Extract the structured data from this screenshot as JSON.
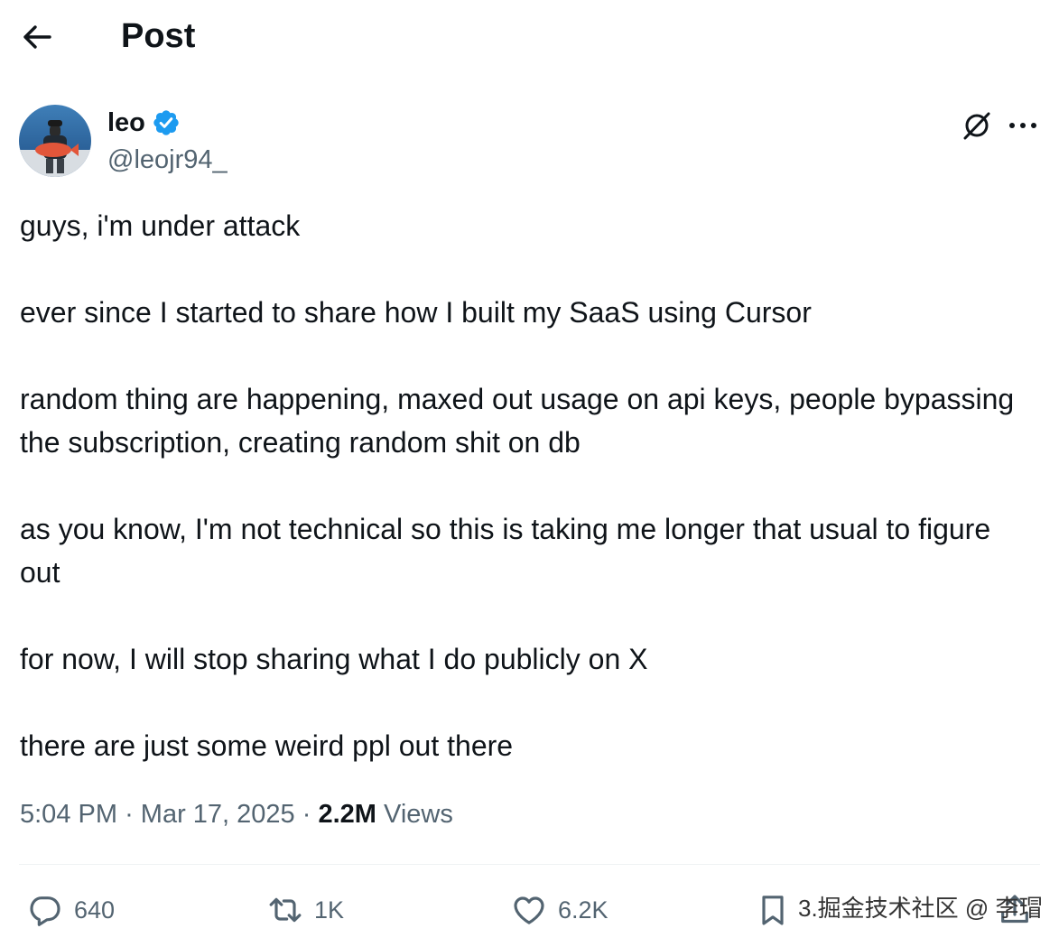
{
  "header": {
    "title": "Post"
  },
  "author": {
    "display_name": "leo",
    "handle": "@leojr94_"
  },
  "post": {
    "paragraphs": [
      "guys, i'm under attack",
      "ever since I started to share how I built my SaaS using Cursor",
      "random thing are happening, maxed out usage on api keys, people bypassing the subscription, creating random shit on db",
      "as you know, I'm not technical so this is taking me longer that usual to figure out",
      "for now, I will stop sharing what I do publicly on X",
      "there are just some weird ppl out there"
    ],
    "time": "5:04 PM",
    "separator": "·",
    "date": "Mar 17, 2025",
    "views_count": "2.2M",
    "views_label": "Views"
  },
  "actions": {
    "replies": "640",
    "reposts": "1K",
    "likes": "6.2K",
    "bookmarks_visible_prefix": "3."
  },
  "watermark": "3.掘金技术社区 @ 李瑁",
  "colors": {
    "text": "#0f1419",
    "secondary": "#536471",
    "verified": "#1d9bf0",
    "divider": "#eff3f4"
  },
  "icons": {
    "back": "arrow-left-icon",
    "verified": "verified-badge-icon",
    "grok": "grok-icon",
    "more": "more-horizontal-icon",
    "reply": "reply-icon",
    "repost": "repost-icon",
    "like": "heart-icon",
    "bookmark": "bookmark-icon",
    "share": "share-icon"
  }
}
